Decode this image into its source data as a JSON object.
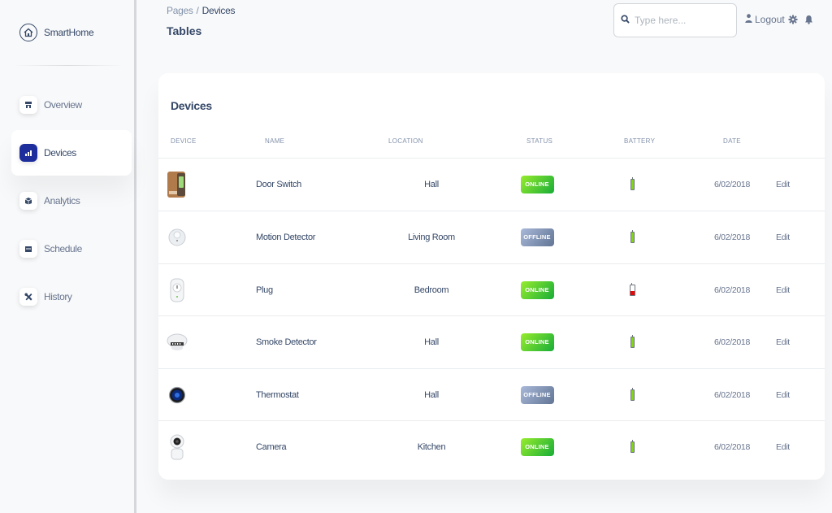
{
  "brand": {
    "name": "SmartHome"
  },
  "nav": [
    {
      "label": "Overview",
      "icon": "store-icon",
      "active": false
    },
    {
      "label": "Devices",
      "icon": "chart-icon",
      "active": true
    },
    {
      "label": "Analytics",
      "icon": "box-icon",
      "active": false
    },
    {
      "label": "Schedule",
      "icon": "calendar-icon",
      "active": false
    },
    {
      "label": "History",
      "icon": "tools-icon",
      "active": false
    }
  ],
  "breadcrumb": {
    "root": "Pages",
    "separator": "/",
    "current": "Devices"
  },
  "page_title": "Tables",
  "search": {
    "placeholder": "Type here..."
  },
  "header": {
    "logout_label": "Logout"
  },
  "table": {
    "title": "Devices",
    "columns": [
      "Device",
      "Name",
      "Location",
      "Status",
      "Battery",
      "Date"
    ],
    "rows": [
      {
        "device": "door-switch",
        "name": "Door Switch",
        "location": "Hall",
        "status": "ONLINE",
        "battery": 1.0,
        "date": "6/02/2018",
        "action": "Edit"
      },
      {
        "device": "motion-detector",
        "name": "Motion Detector",
        "location": "Living Room",
        "status": "OFFLINE",
        "battery": 1.0,
        "date": "6/02/2018",
        "action": "Edit"
      },
      {
        "device": "plug",
        "name": "Plug",
        "location": "Bedroom",
        "status": "ONLINE",
        "battery": 0.2,
        "date": "6/02/2018",
        "action": "Edit"
      },
      {
        "device": "smoke-detector",
        "name": "Smoke Detector",
        "location": "Hall",
        "status": "ONLINE",
        "battery": 1.0,
        "date": "6/02/2018",
        "action": "Edit"
      },
      {
        "device": "thermostat",
        "name": "Thermostat",
        "location": "Hall",
        "status": "OFFLINE",
        "battery": 1.0,
        "date": "6/02/2018",
        "action": "Edit"
      },
      {
        "device": "camera",
        "name": "Camera",
        "location": "Kitchen",
        "status": "ONLINE",
        "battery": 1.0,
        "date": "6/02/2018",
        "action": "Edit"
      }
    ]
  },
  "colors": {
    "accent": "#1d2e9c",
    "online": "#2dce89",
    "offline": "#8392ab",
    "battery_full": "#82d616",
    "battery_low": "#ea0606"
  }
}
